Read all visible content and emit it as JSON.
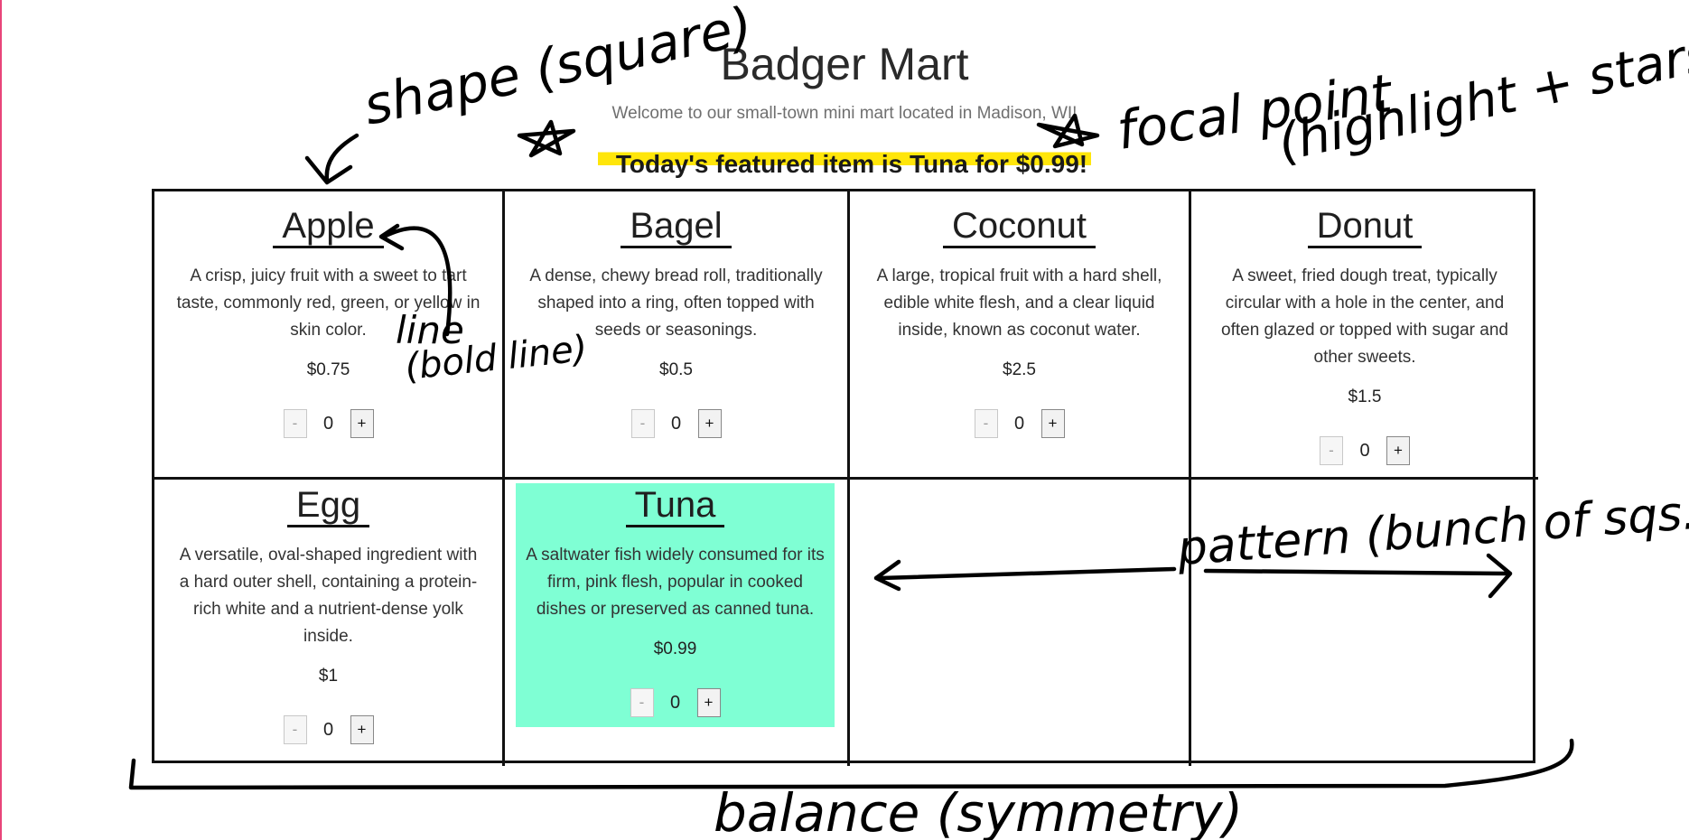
{
  "header": {
    "title": "Badger Mart",
    "subtitle": "Welcome to our small-town mini mart located in Madison, WI!",
    "featured": "Today's featured item is Tuna for $0.99!"
  },
  "products": [
    {
      "name": "Apple",
      "description": "A crisp, juicy fruit with a sweet to tart taste, commonly red, green, or yellow in skin color.",
      "price": "$0.75",
      "qty": "0",
      "minus": "-",
      "plus": "+"
    },
    {
      "name": "Bagel",
      "description": "A dense, chewy bread roll, traditionally shaped into a ring, often topped with seeds or seasonings.",
      "price": "$0.5",
      "qty": "0",
      "minus": "-",
      "plus": "+"
    },
    {
      "name": "Coconut",
      "description": "A large, tropical fruit with a hard shell, edible white flesh, and a clear liquid inside, known as coconut water.",
      "price": "$2.5",
      "qty": "0",
      "minus": "-",
      "plus": "+"
    },
    {
      "name": "Donut",
      "description": "A sweet, fried dough treat, typically circular with a hole in the center, and often glazed or topped with sugar and other sweets.",
      "price": "$1.5",
      "qty": "0",
      "minus": "-",
      "plus": "+"
    },
    {
      "name": "Egg",
      "description": "A versatile, oval-shaped ingredient with a hard outer shell, containing a protein-rich white and a nutrient-dense yolk inside.",
      "price": "$1",
      "qty": "0",
      "minus": "-",
      "plus": "+"
    },
    {
      "name": "Tuna",
      "description": "A saltwater fish widely consumed for its firm, pink flesh, popular in cooked dishes or preserved as canned tuna.",
      "price": "$0.99",
      "qty": "0",
      "minus": "-",
      "plus": "+"
    }
  ],
  "annotations": {
    "shape": "shape (square)",
    "focal_point": "focal point",
    "focal_detail": "(highlight + stars)",
    "line": "line",
    "line_detail": "(bold line)",
    "pattern": "pattern (bunch of sqs.)",
    "balance": "balance (symmetry)"
  },
  "colors": {
    "highlight": "#ffe60a",
    "featured_card": "#7fffd4",
    "border": "#111111"
  }
}
